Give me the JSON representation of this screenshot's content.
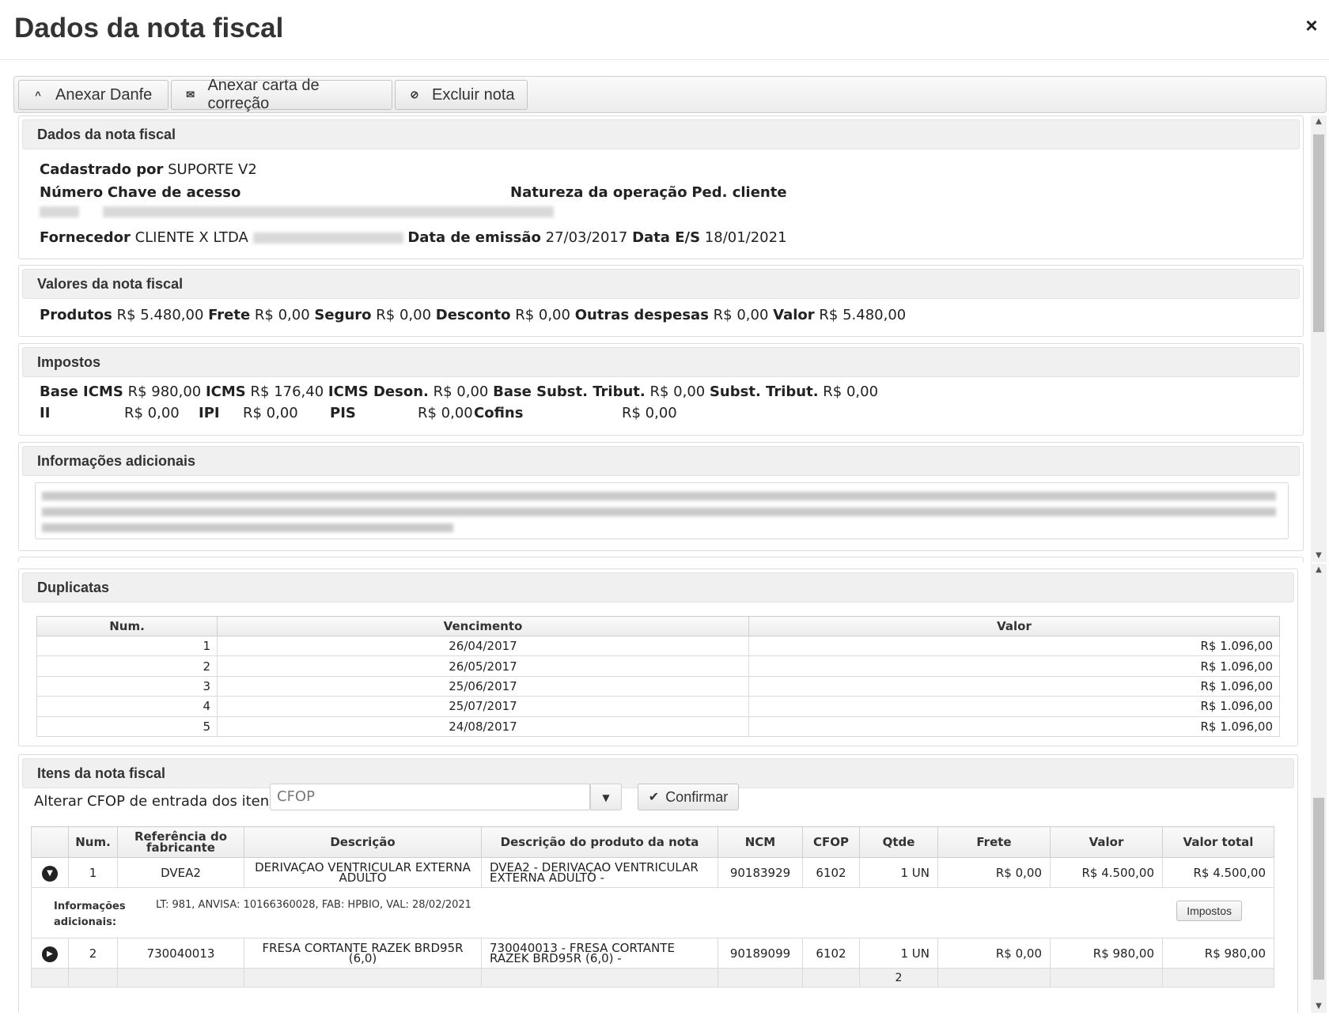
{
  "window": {
    "title": "Dados da nota fiscal",
    "close_icon": "×"
  },
  "toolbar": {
    "anexar_danfe": "Anexar Danfe",
    "anexar_carta": "Anexar carta de correção",
    "excluir_nota": "Excluir nota",
    "icons": {
      "danfe": "^",
      "carta": "✉",
      "excluir": "⊘"
    }
  },
  "dados": {
    "header": "Dados da nota fiscal",
    "cadastrado_label": "Cadastrado por",
    "cadastrado_value": "SUPORTE V2",
    "numero_label": "Número",
    "chave_label": "Chave de acesso",
    "natureza_label": "Natureza da operação",
    "ped_label": "Ped. cliente",
    "fornecedor_label": "Fornecedor",
    "fornecedor_value": "CLIENTE X LTDA",
    "emissao_label": "Data de emissão",
    "emissao_value": "27/03/2017",
    "es_label": "Data E/S",
    "es_value": "18/01/2021"
  },
  "valores": {
    "header": "Valores da nota fiscal",
    "produtos_label": "Produtos",
    "produtos_value": "R$ 5.480,00",
    "frete_label": "Frete",
    "frete_value": "R$ 0,00",
    "seguro_label": "Seguro",
    "seguro_value": "R$ 0,00",
    "desconto_label": "Desconto",
    "desconto_value": "R$ 0,00",
    "outras_label": "Outras despesas",
    "outras_value": "R$ 0,00",
    "valor_label": "Valor",
    "valor_value": "R$ 5.480,00"
  },
  "impostos": {
    "header": "Impostos",
    "base_icms_label": "Base ICMS",
    "base_icms_value": "R$ 980,00",
    "icms_label": "ICMS",
    "icms_value": "R$ 176,40",
    "icms_deson_label": "ICMS Deson.",
    "icms_deson_value": "R$ 0,00",
    "base_subst_label": "Base Subst. Tribut.",
    "base_subst_value": "R$ 0,00",
    "subst_label": "Subst. Tribut.",
    "subst_value": "R$ 0,00",
    "ii_label": "II",
    "ii_value": "R$ 0,00",
    "ipi_label": "IPI",
    "ipi_value": "R$ 0,00",
    "pis_label": "PIS",
    "pis_value": "R$ 0,00",
    "cofins_label": "Cofins",
    "cofins_value": "R$ 0,00"
  },
  "info": {
    "header": "Informações adicionais"
  },
  "duplicatas": {
    "header": "Duplicatas",
    "columns": [
      "Num.",
      "Vencimento",
      "Valor"
    ],
    "rows": [
      [
        "1",
        "26/04/2017",
        "R$ 1.096,00"
      ],
      [
        "2",
        "26/05/2017",
        "R$ 1.096,00"
      ],
      [
        "3",
        "25/06/2017",
        "R$ 1.096,00"
      ],
      [
        "4",
        "25/07/2017",
        "R$ 1.096,00"
      ],
      [
        "5",
        "24/08/2017",
        "R$ 1.096,00"
      ]
    ]
  },
  "itens": {
    "header": "Itens da nota fiscal",
    "cfop_label": "Alterar CFOP de entrada dos itens",
    "cfop_placeholder": "CFOP",
    "confirm_label": "Confirmar",
    "columns": [
      "Num.",
      "Referência do fabricante",
      "Descrição",
      "Descrição do produto da nota",
      "NCM",
      "CFOP",
      "Qtde",
      "Frete",
      "Valor",
      "Valor total"
    ],
    "rows": [
      [
        "1",
        "DVEA2",
        "DERIVAÇAO VENTRICULAR EXTERNA ADULTO",
        "DVEA2 - DERIVAÇAO VENTRICULAR EXTERNA ADULTO -",
        "90183929",
        "6102",
        "1 UN",
        "R$ 0,00",
        "R$ 4.500,00",
        "R$ 4.500,00"
      ],
      [
        "2",
        "730040013",
        "FRESA CORTANTE RAZEK BRD95R (6,0)",
        "730040013 - FRESA CORTANTE RAZEK BRD95R (6,0) -",
        "90189099",
        "6102",
        "1 UN",
        "R$ 0,00",
        "R$ 980,00",
        "R$ 980,00"
      ]
    ],
    "detail_label": "Informações adicionais:",
    "detail_value": "LT: 981, ANVISA: 10166360028, FAB: HPBIO, VAL: 28/02/2021",
    "impostos_btn": "Impostos",
    "footer_qtde": "2"
  }
}
